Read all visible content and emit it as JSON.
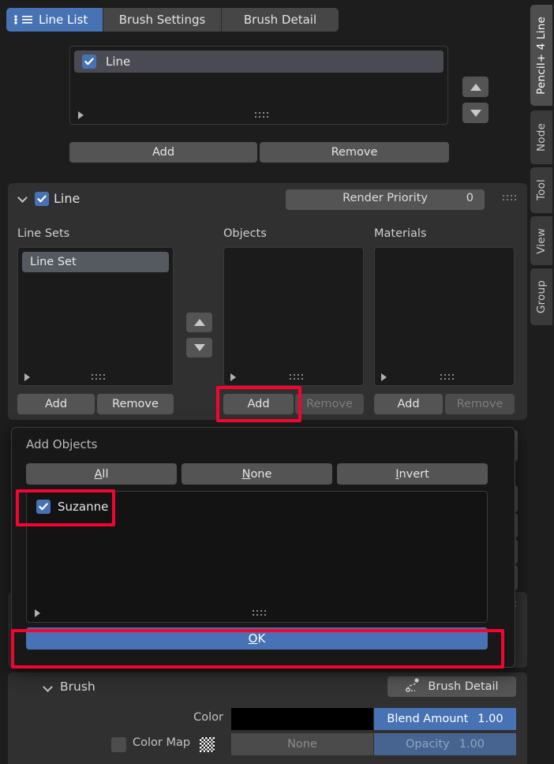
{
  "tabs": [
    {
      "label": "Line List",
      "icon": "list-icon",
      "active": true
    },
    {
      "label": "Brush Settings",
      "icon": "",
      "active": false
    },
    {
      "label": "Brush Detail",
      "icon": "",
      "active": false
    }
  ],
  "line_list": {
    "item_label": "Line",
    "item_checked": true,
    "add_label": "Add",
    "remove_label": "Remove",
    "move_up_icon": "arrow-up-icon",
    "move_down_icon": "arrow-down-icon",
    "expand_icon": "triangle-right-icon",
    "grip_icon": "grip-dots-icon"
  },
  "line_panel": {
    "title": "Line",
    "checked": true,
    "collapse_icon": "chevron-down-icon",
    "render_priority_label": "Render Priority",
    "render_priority_value": "0",
    "drag_icon": "grip-dots-icon",
    "columns": {
      "line_sets": {
        "header": "Line Sets",
        "items": [
          "Line Set"
        ],
        "add_label": "Add",
        "remove_label": "Remove",
        "remove_disabled": false
      },
      "objects": {
        "header": "Objects",
        "items": [],
        "add_label": "Add",
        "remove_label": "Remove",
        "remove_disabled": true
      },
      "materials": {
        "header": "Materials",
        "items": [],
        "add_label": "Add",
        "remove_label": "Remove",
        "remove_disabled": true
      }
    },
    "reorder_up_icon": "arrow-up-icon",
    "reorder_down_icon": "arrow-down-icon"
  },
  "dialog": {
    "title": "Add Objects",
    "all_label": "All",
    "all_accel": "A",
    "none_label": "None",
    "none_accel": "N",
    "invert_label": "Invert",
    "invert_accel": "I",
    "items": [
      {
        "label": "Suzanne",
        "checked": true
      }
    ],
    "ok_label": "OK",
    "ok_accel": "O",
    "expand_icon": "triangle-right-icon",
    "grip_icon": "grip-dots-icon"
  },
  "brush_panel": {
    "title": "Brush",
    "collapse_icon": "chevron-down-icon",
    "detail_button_label": "Brush Detail",
    "detail_button_icon": "spline-curve-icon",
    "color_label": "Color",
    "color_value": "#000000",
    "blend_amount_label": "Blend Amount",
    "blend_amount_value": "1.00",
    "color_map_label": "Color Map",
    "color_map_checked": false,
    "color_map_texture_icon": "checker-icon",
    "color_map_none_label": "None",
    "opacity_label": "Opacity",
    "opacity_value": "1.00"
  },
  "rail_tabs": [
    {
      "label": "Pencil+ 4 Line",
      "active": true
    },
    {
      "label": "Node",
      "active": false
    },
    {
      "label": "Tool",
      "active": false
    },
    {
      "label": "View",
      "active": false
    },
    {
      "label": "Group",
      "active": false
    }
  ],
  "colors": {
    "accent_blue": "#4772b3",
    "annotation_red": "#f5042f",
    "panel_bg": "#303030",
    "window_bg": "#1d1d1d"
  }
}
